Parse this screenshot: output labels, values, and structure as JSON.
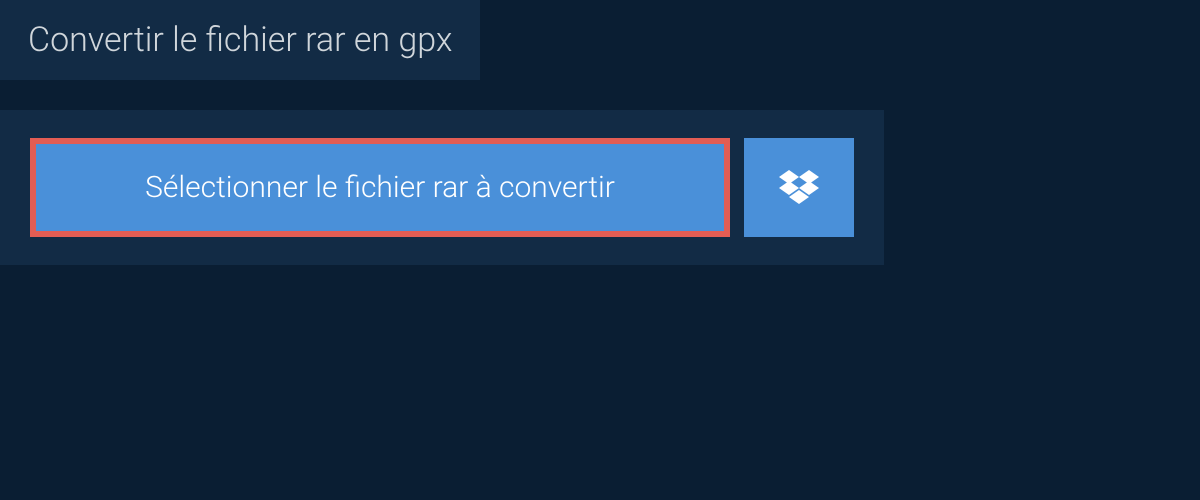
{
  "header": {
    "title": "Convertir le fichier rar en gpx"
  },
  "converter": {
    "select_button_label": "Sélectionner le fichier rar à convertir",
    "dropbox_icon_name": "dropbox-icon"
  },
  "colors": {
    "background": "#0a1e33",
    "panel": "#122b45",
    "button": "#4a90d9",
    "highlight_border": "#e35d54",
    "text_light": "#d0d6db",
    "text_white": "#ffffff"
  }
}
